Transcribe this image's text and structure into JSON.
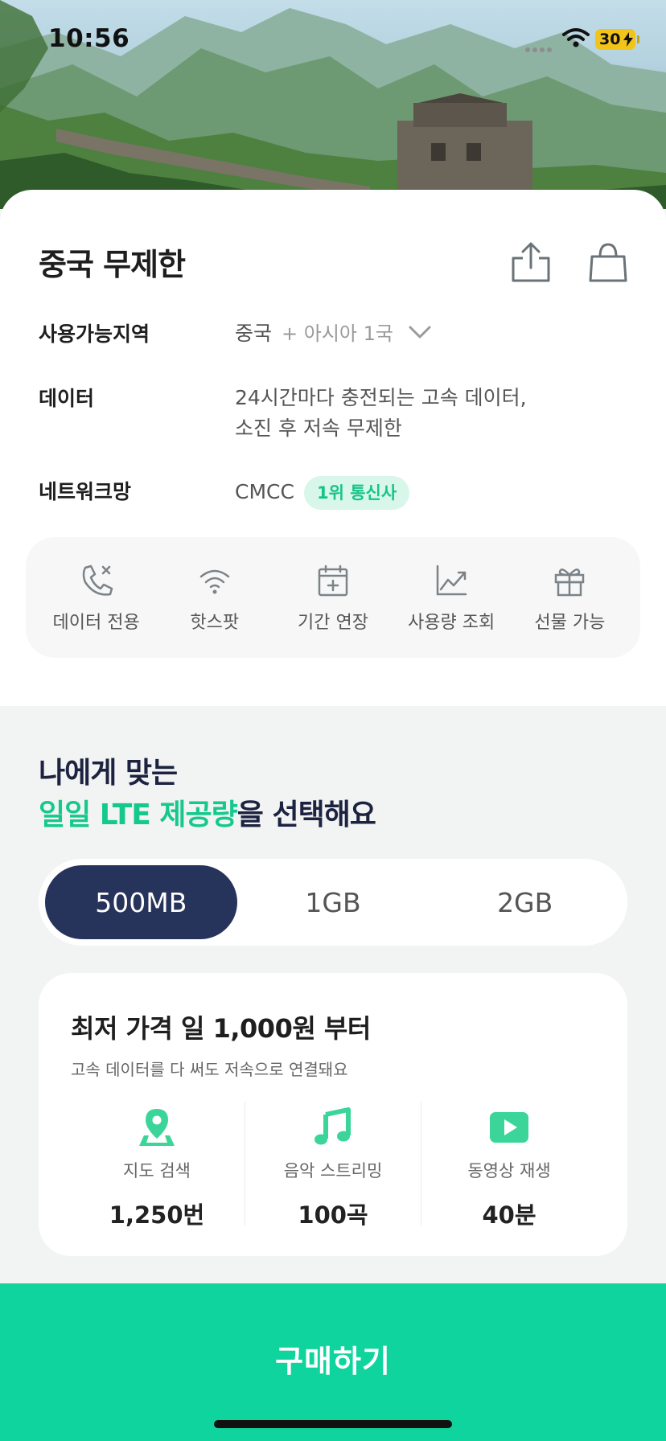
{
  "status_bar": {
    "time": "10:56",
    "battery": "30"
  },
  "product": {
    "title": "중국 무제한",
    "share_icon": "share-icon",
    "bag_icon": "shopping-bag-icon",
    "region": {
      "label": "사용가능지역",
      "main": "중국",
      "extra": "+ 아시아 1국"
    },
    "data": {
      "label": "데이터",
      "line1": "24시간마다 충전되는 고속 데이터,",
      "line2": "소진 후 저속 무제한"
    },
    "network": {
      "label": "네트워크망",
      "name": "CMCC",
      "badge": "1위 통신사"
    },
    "features": [
      {
        "label": "데이터 전용",
        "icon": "phone-off-icon"
      },
      {
        "label": "핫스팟",
        "icon": "wifi-icon"
      },
      {
        "label": "기간 연장",
        "icon": "calendar-plus-icon"
      },
      {
        "label": "사용량 조회",
        "icon": "chart-up-icon"
      },
      {
        "label": "선물 가능",
        "icon": "gift-icon"
      }
    ]
  },
  "selection": {
    "head_line1": "나에게 맞는",
    "head_accent": "일일 LTE 제공량",
    "head_rest": "을 선택해요",
    "options": [
      "500MB",
      "1GB",
      "2GB"
    ],
    "selected": "500MB"
  },
  "price": {
    "title": "최저 가격 일 1,000원 부터",
    "subtitle": "고속 데이터를 다 써도 저속으로 연결돼요",
    "usage": [
      {
        "label": "지도 검색",
        "value": "1,250번",
        "icon": "map-pin-icon"
      },
      {
        "label": "음악 스트리밍",
        "value": "100곡",
        "icon": "music-note-icon"
      },
      {
        "label": "동영상 재생",
        "value": "40분",
        "icon": "play-video-icon"
      }
    ]
  },
  "buy": {
    "label": "구매하기"
  },
  "colors": {
    "accent": "#0fd49d",
    "navy": "#26335a",
    "badge_bg": "#d8f7ea",
    "badge_text": "#16c48a"
  }
}
